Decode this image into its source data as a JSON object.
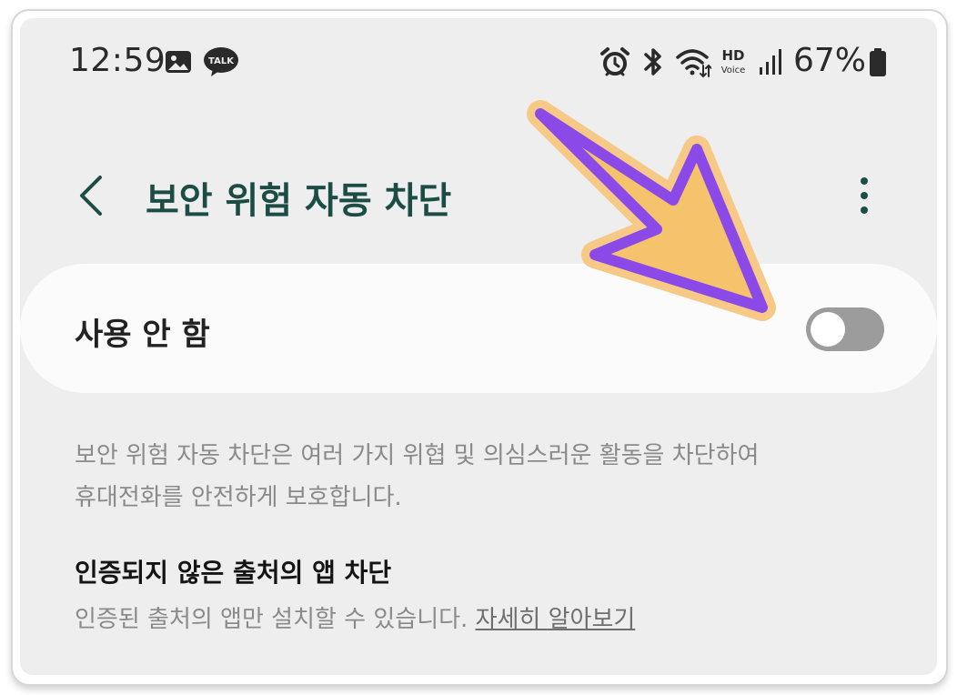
{
  "status_bar": {
    "time": "12:59",
    "left_icons": [
      "gallery-icon",
      "kakaotalk-icon"
    ],
    "talk_badge": "TALK",
    "right_icons": [
      "alarm-icon",
      "bluetooth-icon",
      "wifi-icon",
      "hd-voice-icon",
      "signal-icon",
      "battery-icon"
    ],
    "hd_label": "HD",
    "voice_label": "Voice",
    "battery_percent": "67%"
  },
  "header": {
    "back_icon": "chevron-left-icon",
    "title": "보안 위험 자동 차단",
    "more_icon": "more-vertical-icon"
  },
  "master_switch": {
    "label": "사용 안 함",
    "state": "off"
  },
  "description": {
    "line1": "보안 위험 자동 차단은 여러 가지 위협 및 의심스러운 활동을 차단하여",
    "line2": "휴대전화를 안전하게 보호합니다."
  },
  "setting_block_unverified": {
    "title": "인증되지 않은 출처의 앱 차단",
    "summary": "인증된 출처의 앱만 설치할 수 있습니다.",
    "link": "자세히 알아보기"
  },
  "colors": {
    "title_green": "#1c4d44",
    "toggle_off": "#9c9c9c",
    "arrow_fill": "#f5c36b",
    "arrow_stroke": "#8b4ae8",
    "screen_bg": "#eeeeee",
    "card_bg": "#fbfbfb"
  }
}
